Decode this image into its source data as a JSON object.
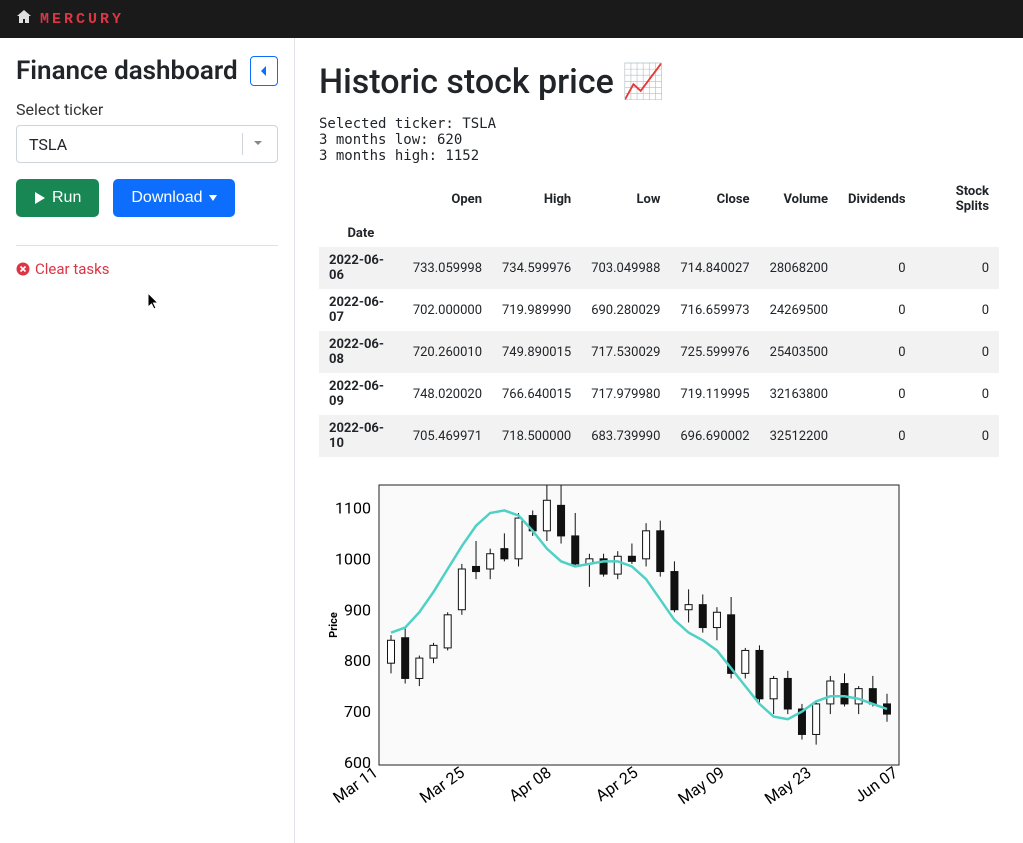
{
  "brand": "MERCURY",
  "sidebar": {
    "title": "Finance dashboard",
    "select_label": "Select ticker",
    "select_value": "TSLA",
    "run_label": "Run",
    "download_label": "Download",
    "clear_label": "Clear tasks"
  },
  "main": {
    "title": "Historic stock price 📈",
    "info_lines": "Selected ticker: TSLA\n3 months low: 620\n3 months high: 1152"
  },
  "table": {
    "columns": [
      "Open",
      "High",
      "Low",
      "Close",
      "Volume",
      "Dividends",
      "Stock Splits"
    ],
    "row_header": "Date",
    "rows": [
      {
        "date": "2022-06-06",
        "open": "733.059998",
        "high": "734.599976",
        "low": "703.049988",
        "close": "714.840027",
        "volume": "28068200",
        "dividends": "0",
        "splits": "0"
      },
      {
        "date": "2022-06-07",
        "open": "702.000000",
        "high": "719.989990",
        "low": "690.280029",
        "close": "716.659973",
        "volume": "24269500",
        "dividends": "0",
        "splits": "0"
      },
      {
        "date": "2022-06-08",
        "open": "720.260010",
        "high": "749.890015",
        "low": "717.530029",
        "close": "725.599976",
        "volume": "25403500",
        "dividends": "0",
        "splits": "0"
      },
      {
        "date": "2022-06-09",
        "open": "748.020020",
        "high": "766.640015",
        "low": "717.979980",
        "close": "719.119995",
        "volume": "32163800",
        "dividends": "0",
        "splits": "0"
      },
      {
        "date": "2022-06-10",
        "open": "705.469971",
        "high": "718.500000",
        "low": "683.739990",
        "close": "696.690002",
        "volume": "32512200",
        "dividends": "0",
        "splits": "0"
      }
    ]
  },
  "chart_data": {
    "type": "candlestick",
    "title": "",
    "ylabel": "Price",
    "ylim": [
      600,
      1150
    ],
    "x_ticks": [
      "Mar 11",
      "Mar 25",
      "Apr 08",
      "Apr 25",
      "May 09",
      "May 23",
      "Jun 07"
    ],
    "series": [
      {
        "name": "TSLA",
        "candles": [
          {
            "open": 800,
            "high": 855,
            "low": 780,
            "close": 845
          },
          {
            "open": 850,
            "high": 870,
            "low": 760,
            "close": 770
          },
          {
            "open": 770,
            "high": 815,
            "low": 755,
            "close": 810
          },
          {
            "open": 810,
            "high": 840,
            "low": 800,
            "close": 835
          },
          {
            "open": 830,
            "high": 900,
            "low": 825,
            "close": 895
          },
          {
            "open": 905,
            "high": 995,
            "low": 895,
            "close": 985
          },
          {
            "open": 990,
            "high": 1040,
            "low": 965,
            "close": 980
          },
          {
            "open": 985,
            "high": 1025,
            "low": 965,
            "close": 1015
          },
          {
            "open": 1025,
            "high": 1055,
            "low": 1000,
            "close": 1005
          },
          {
            "open": 1005,
            "high": 1095,
            "low": 990,
            "close": 1085
          },
          {
            "open": 1090,
            "high": 1100,
            "low": 1050,
            "close": 1060
          },
          {
            "open": 1060,
            "high": 1150,
            "low": 1040,
            "close": 1120
          },
          {
            "open": 1110,
            "high": 1150,
            "low": 1035,
            "close": 1050
          },
          {
            "open": 1050,
            "high": 1095,
            "low": 990,
            "close": 995
          },
          {
            "open": 995,
            "high": 1015,
            "low": 950,
            "close": 1005
          },
          {
            "open": 1005,
            "high": 1015,
            "low": 970,
            "close": 975
          },
          {
            "open": 975,
            "high": 1020,
            "low": 965,
            "close": 1010
          },
          {
            "open": 1010,
            "high": 1035,
            "low": 995,
            "close": 1000
          },
          {
            "open": 1005,
            "high": 1075,
            "low": 990,
            "close": 1060
          },
          {
            "open": 1060,
            "high": 1080,
            "low": 970,
            "close": 980
          },
          {
            "open": 980,
            "high": 1000,
            "low": 900,
            "close": 905
          },
          {
            "open": 905,
            "high": 945,
            "low": 880,
            "close": 915
          },
          {
            "open": 915,
            "high": 935,
            "low": 860,
            "close": 870
          },
          {
            "open": 870,
            "high": 910,
            "low": 845,
            "close": 900
          },
          {
            "open": 895,
            "high": 930,
            "low": 770,
            "close": 780
          },
          {
            "open": 780,
            "high": 830,
            "low": 770,
            "close": 825
          },
          {
            "open": 825,
            "high": 835,
            "low": 720,
            "close": 730
          },
          {
            "open": 730,
            "high": 775,
            "low": 700,
            "close": 770
          },
          {
            "open": 770,
            "high": 785,
            "low": 700,
            "close": 710
          },
          {
            "open": 710,
            "high": 720,
            "low": 650,
            "close": 660
          },
          {
            "open": 660,
            "high": 725,
            "low": 640,
            "close": 720
          },
          {
            "open": 720,
            "high": 775,
            "low": 700,
            "close": 765
          },
          {
            "open": 760,
            "high": 780,
            "low": 715,
            "close": 720
          },
          {
            "open": 720,
            "high": 755,
            "low": 700,
            "close": 750
          },
          {
            "open": 750,
            "high": 775,
            "low": 715,
            "close": 720
          },
          {
            "open": 720,
            "high": 740,
            "low": 685,
            "close": 700
          }
        ]
      },
      {
        "name": "smooth",
        "type": "line",
        "y": [
          860,
          870,
          900,
          940,
          985,
          1030,
          1070,
          1095,
          1100,
          1090,
          1060,
          1025,
          1000,
          990,
          995,
          1000,
          1000,
          990,
          965,
          925,
          885,
          860,
          845,
          825,
          790,
          755,
          720,
          695,
          690,
          705,
          725,
          735,
          735,
          730,
          720,
          710
        ]
      }
    ]
  }
}
